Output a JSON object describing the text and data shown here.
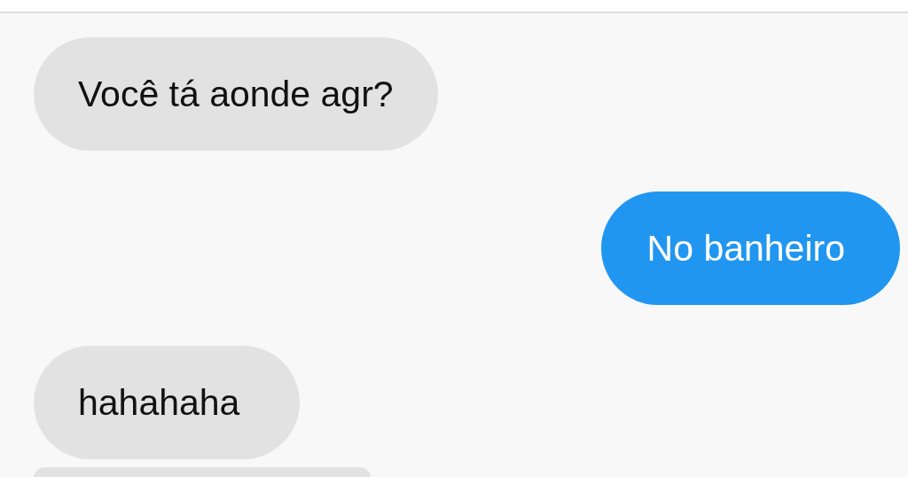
{
  "messages": [
    {
      "kind": "received",
      "text": "Você tá aonde agr?"
    },
    {
      "kind": "sent",
      "text": "No banheiro"
    },
    {
      "kind": "received",
      "text": "hahahaha"
    }
  ]
}
